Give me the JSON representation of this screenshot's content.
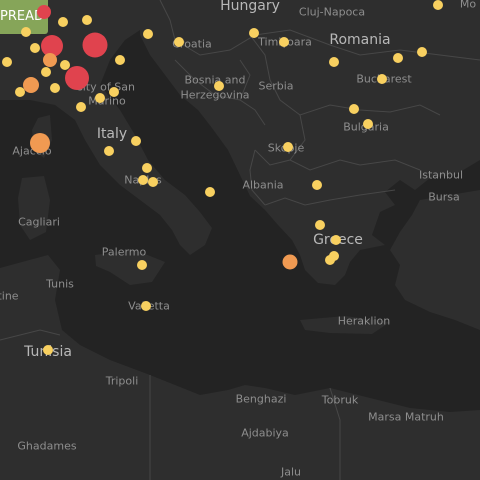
{
  "toolbar": {
    "spread_label": "PREAD"
  },
  "colors": {
    "low": "#f8d060",
    "medium": "#f09a52",
    "high": "#e0434e",
    "land": "#2f2f2f",
    "sea": "#232323"
  },
  "labels": [
    {
      "id": "hungary",
      "text": "Hungary",
      "kind": "country"
    },
    {
      "id": "cluj-napoca",
      "text": "Cluj-Napoca",
      "kind": "city"
    },
    {
      "id": "croatia",
      "text": "Croatia",
      "kind": "city"
    },
    {
      "id": "timisoara",
      "text": "Timișoara",
      "kind": "city"
    },
    {
      "id": "romania",
      "text": "Romania",
      "kind": "country"
    },
    {
      "id": "moldova",
      "text": "Mo",
      "kind": "city"
    },
    {
      "id": "bosnia",
      "text": "Bosnia and",
      "kind": "city"
    },
    {
      "id": "herzegovina",
      "text": "Herzegovina",
      "kind": "city"
    },
    {
      "id": "serbia",
      "text": "Serbia",
      "kind": "city"
    },
    {
      "id": "bucharest",
      "text": "Bucharest",
      "kind": "city"
    },
    {
      "id": "city-of-san",
      "text": "City of San",
      "kind": "city"
    },
    {
      "id": "marino",
      "text": "Marino",
      "kind": "city"
    },
    {
      "id": "italy",
      "text": "Italy",
      "kind": "country"
    },
    {
      "id": "bulgaria",
      "text": "Bulgaria",
      "kind": "city"
    },
    {
      "id": "ajaccio",
      "text": "Ajaccio",
      "kind": "city"
    },
    {
      "id": "skopje",
      "text": "Skopje",
      "kind": "city"
    },
    {
      "id": "naples",
      "text": "Naples",
      "kind": "city"
    },
    {
      "id": "istanbul",
      "text": "Istanbul",
      "kind": "city"
    },
    {
      "id": "albania",
      "text": "Albania",
      "kind": "city"
    },
    {
      "id": "bursa",
      "text": "Bursa",
      "kind": "city"
    },
    {
      "id": "cagliari",
      "text": "Cagliari",
      "kind": "city"
    },
    {
      "id": "greece",
      "text": "Greece",
      "kind": "country"
    },
    {
      "id": "palermo",
      "text": "Palermo",
      "kind": "city"
    },
    {
      "id": "tunis",
      "text": "Tunis",
      "kind": "city"
    },
    {
      "id": "tine",
      "text": "tine",
      "kind": "city"
    },
    {
      "id": "valletta",
      "text": "Valletta",
      "kind": "city"
    },
    {
      "id": "heraklion",
      "text": "Heraklion",
      "kind": "city"
    },
    {
      "id": "tunisia",
      "text": "Tunisia",
      "kind": "country"
    },
    {
      "id": "tripoli",
      "text": "Tripoli",
      "kind": "city"
    },
    {
      "id": "benghazi",
      "text": "Benghazi",
      "kind": "city"
    },
    {
      "id": "tobruk",
      "text": "Tobruk",
      "kind": "city"
    },
    {
      "id": "marsa-matruh",
      "text": "Marsa Matruh",
      "kind": "city"
    },
    {
      "id": "ajdabiya",
      "text": "Ajdabiya",
      "kind": "city"
    },
    {
      "id": "ghadames",
      "text": "Ghadames",
      "kind": "city"
    },
    {
      "id": "jalu",
      "text": "Jalu",
      "kind": "city"
    }
  ],
  "markers": [
    {
      "level": "high"
    },
    {
      "level": "high"
    },
    {
      "level": "high"
    },
    {
      "level": "medium"
    },
    {
      "level": "medium"
    },
    {
      "level": "medium"
    },
    {
      "level": "high"
    },
    {
      "level": "medium"
    },
    {
      "level": "low"
    },
    {
      "level": "low"
    },
    {
      "level": "low"
    },
    {
      "level": "low"
    },
    {
      "level": "low"
    },
    {
      "level": "low"
    },
    {
      "level": "low"
    },
    {
      "level": "low"
    },
    {
      "level": "low"
    },
    {
      "level": "low"
    },
    {
      "level": "low"
    },
    {
      "level": "low"
    },
    {
      "level": "low"
    },
    {
      "level": "low"
    },
    {
      "level": "low"
    },
    {
      "level": "low"
    },
    {
      "level": "low"
    },
    {
      "level": "low"
    },
    {
      "level": "low"
    },
    {
      "level": "low"
    },
    {
      "level": "low"
    },
    {
      "level": "low"
    },
    {
      "level": "low"
    },
    {
      "level": "low"
    },
    {
      "level": "low"
    },
    {
      "level": "low"
    },
    {
      "level": "low"
    },
    {
      "level": "low"
    },
    {
      "level": "low"
    },
    {
      "level": "low"
    },
    {
      "level": "low"
    },
    {
      "level": "low"
    },
    {
      "level": "low"
    },
    {
      "level": "low"
    },
    {
      "level": "low"
    },
    {
      "level": "low"
    },
    {
      "level": "low"
    },
    {
      "level": "low"
    },
    {
      "level": "low"
    },
    {
      "level": "low"
    }
  ]
}
